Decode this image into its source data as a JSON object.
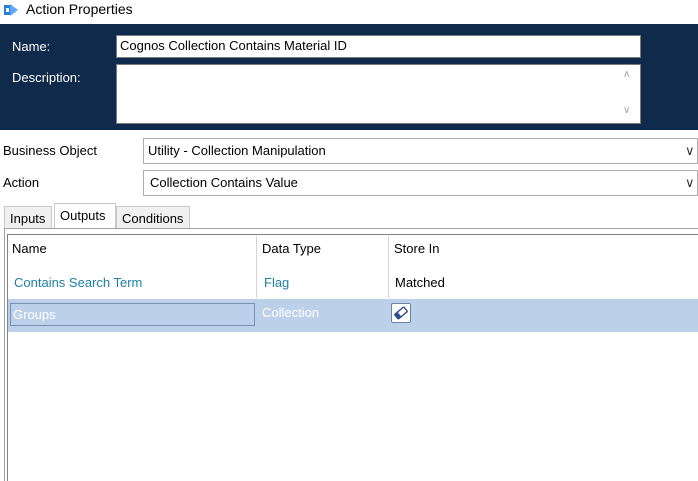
{
  "window": {
    "title": "Action Properties"
  },
  "header": {
    "name_label": "Name:",
    "name_value": "Cognos Collection Contains Material ID",
    "description_label": "Description:",
    "description_value": ""
  },
  "business_object": {
    "label": "Business Object",
    "value": "Utility - Collection Manipulation"
  },
  "action": {
    "label": "Action",
    "value": "Collection Contains Value"
  },
  "tabs": [
    {
      "label": "Inputs",
      "active": false
    },
    {
      "label": "Outputs",
      "active": true
    },
    {
      "label": "Conditions",
      "active": false
    }
  ],
  "outputs_table": {
    "columns": [
      "Name",
      "Data Type",
      "Store In"
    ],
    "rows": [
      {
        "name": "Contains Search Term",
        "data_type": "Flag",
        "store_in": "Matched"
      },
      {
        "name": "Groups",
        "data_type": "Collection",
        "store_in": ""
      }
    ]
  },
  "icons": {
    "app": "app-icon",
    "scroll_up": "scroll-up-icon",
    "scroll_down": "scroll-down-icon",
    "dropdown": "chevron-down-icon",
    "store": "eraser-icon"
  },
  "colors": {
    "header_bg": "#0f2a4a",
    "link_text": "#1f7fa6",
    "selected_row": "#bdd0ea"
  }
}
